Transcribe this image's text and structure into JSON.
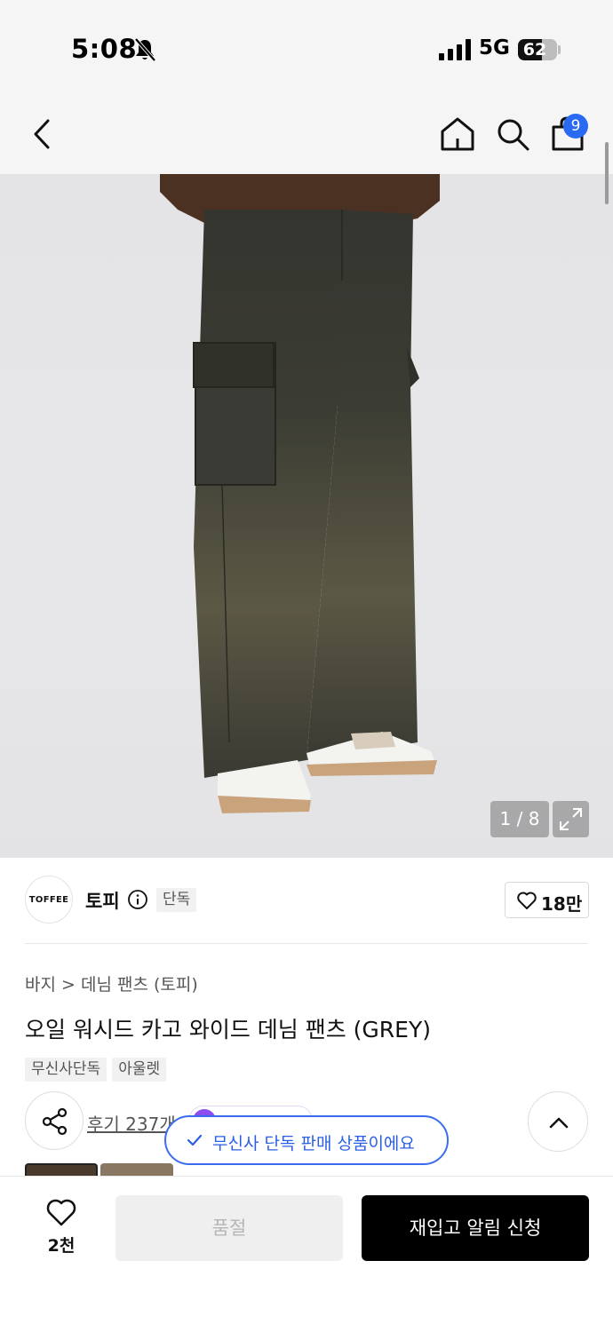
{
  "status_bar": {
    "time": "5:08",
    "network": "5G",
    "battery": "62",
    "battery_level": 0.62,
    "icons": [
      "bell-off-icon",
      "signal-icon",
      "battery-icon"
    ]
  },
  "nav": {
    "icons": [
      "back-icon",
      "home-icon",
      "search-icon",
      "shopping-bag-icon"
    ],
    "cart_badge": "9",
    "badge_color": "#2a6af3"
  },
  "gallery": {
    "counter": "1 / 8",
    "expand_icon": "expand-icon"
  },
  "brand": {
    "logo_text": "TOFFEE",
    "name": "토피",
    "exclusive_tag": "단독",
    "likes": "18만"
  },
  "product": {
    "breadcrumb": "바지 > 데님 팬츠 (토피)",
    "title": "오일 워시드 카고 와이드 데님 팬츠 (GREY)",
    "tags": [
      "무신사단독",
      "아울렛"
    ],
    "review_link": "후기 237개"
  },
  "toast": {
    "text": "무신사 단독 판매 상품이에요",
    "color": "#2b5fe3"
  },
  "bottom_bar": {
    "wish_count": "2천",
    "soldout_label": "품절",
    "restock_label": "재입고 알림 신청"
  }
}
